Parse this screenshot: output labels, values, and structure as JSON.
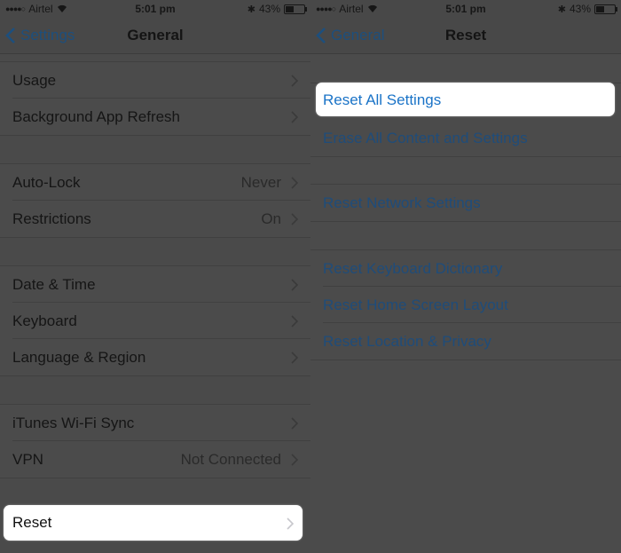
{
  "status": {
    "carrier": "Airtel",
    "time": "5:01 pm",
    "battery": "43%",
    "battery_level": 0.43
  },
  "left": {
    "back_label": "Settings",
    "title": "General",
    "group1": [
      "Usage",
      "Background App Refresh"
    ],
    "group2": [
      {
        "label": "Auto-Lock",
        "value": "Never"
      },
      {
        "label": "Restrictions",
        "value": "On"
      }
    ],
    "group3": [
      "Date & Time",
      "Keyboard",
      "Language & Region"
    ],
    "group4": [
      {
        "label": "iTunes Wi-Fi Sync",
        "value": ""
      },
      {
        "label": "VPN",
        "value": "Not Connected"
      }
    ],
    "reset_label": "Reset"
  },
  "right": {
    "back_label": "General",
    "title": "Reset",
    "group1": [
      "Reset All Settings",
      "Erase All Content and Settings"
    ],
    "group2": [
      "Reset Network Settings"
    ],
    "group3": [
      "Reset Keyboard Dictionary",
      "Reset Home Screen Layout",
      "Reset Location & Privacy"
    ]
  },
  "colors": {
    "accent": "#1a73c7",
    "dim_accent": "#1f4c7a",
    "highlight": "#ffffff"
  }
}
